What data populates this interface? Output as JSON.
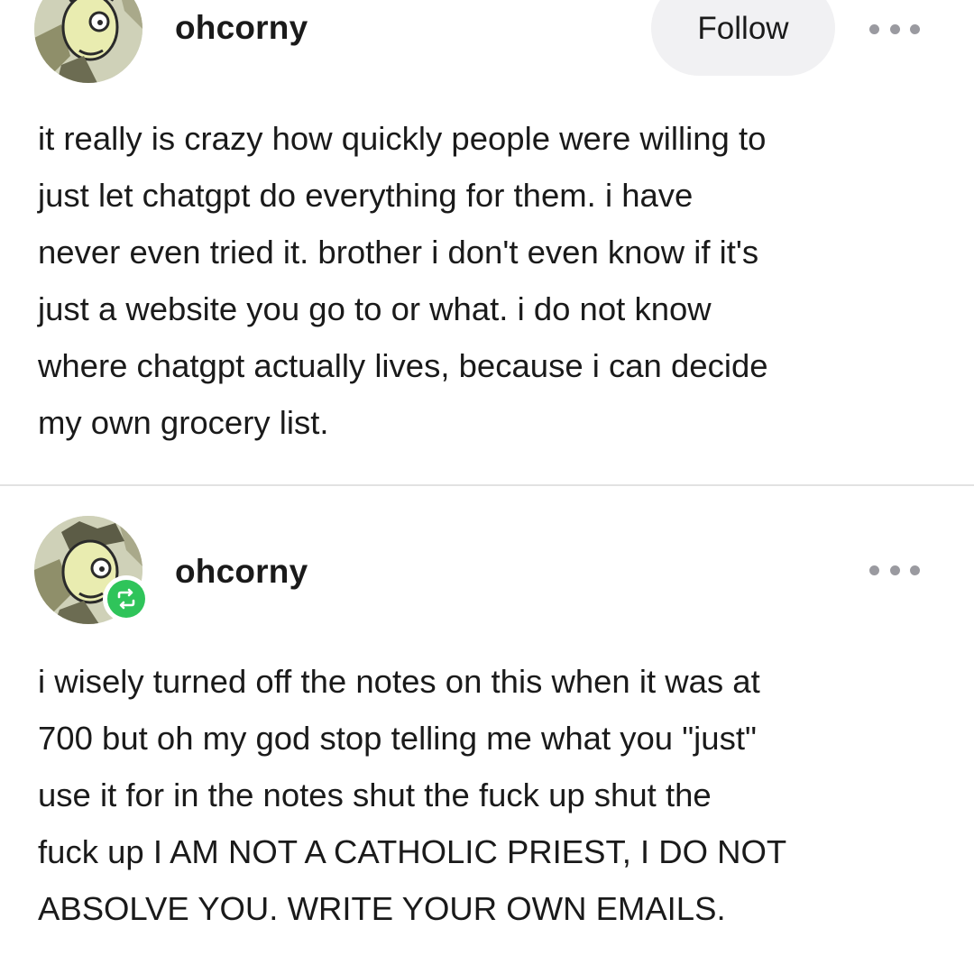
{
  "posts": [
    {
      "username": "ohcorny",
      "follow_label": "Follow",
      "more_icon": "more-horizontal-icon",
      "text": "it really is crazy how quickly people were willing to\njust let chatgpt do everything for them. i have\nnever even tried it. brother i don't even know if it's\njust a website you go to or what. i do not know\nwhere chatgpt actually lives, because i can decide\nmy own grocery list."
    },
    {
      "username": "ohcorny",
      "reblog_icon": "reblog-icon",
      "more_icon": "more-horizontal-icon",
      "text": "i wisely turned off the notes on this when it was at\n700 but oh my god stop telling me what you \"just\"\nuse it for in the notes shut the fuck up shut the\nfuck up I AM NOT A CATHOLIC PRIEST, I DO NOT\nABSOLVE YOU. WRITE YOUR OWN EMAILS."
    }
  ],
  "colors": {
    "text": "#1a1a1a",
    "follow_bg": "#f1f1f3",
    "dots": "#9a9aa0",
    "reblog_green": "#2fc45a",
    "divider": "#e2e2e2"
  }
}
